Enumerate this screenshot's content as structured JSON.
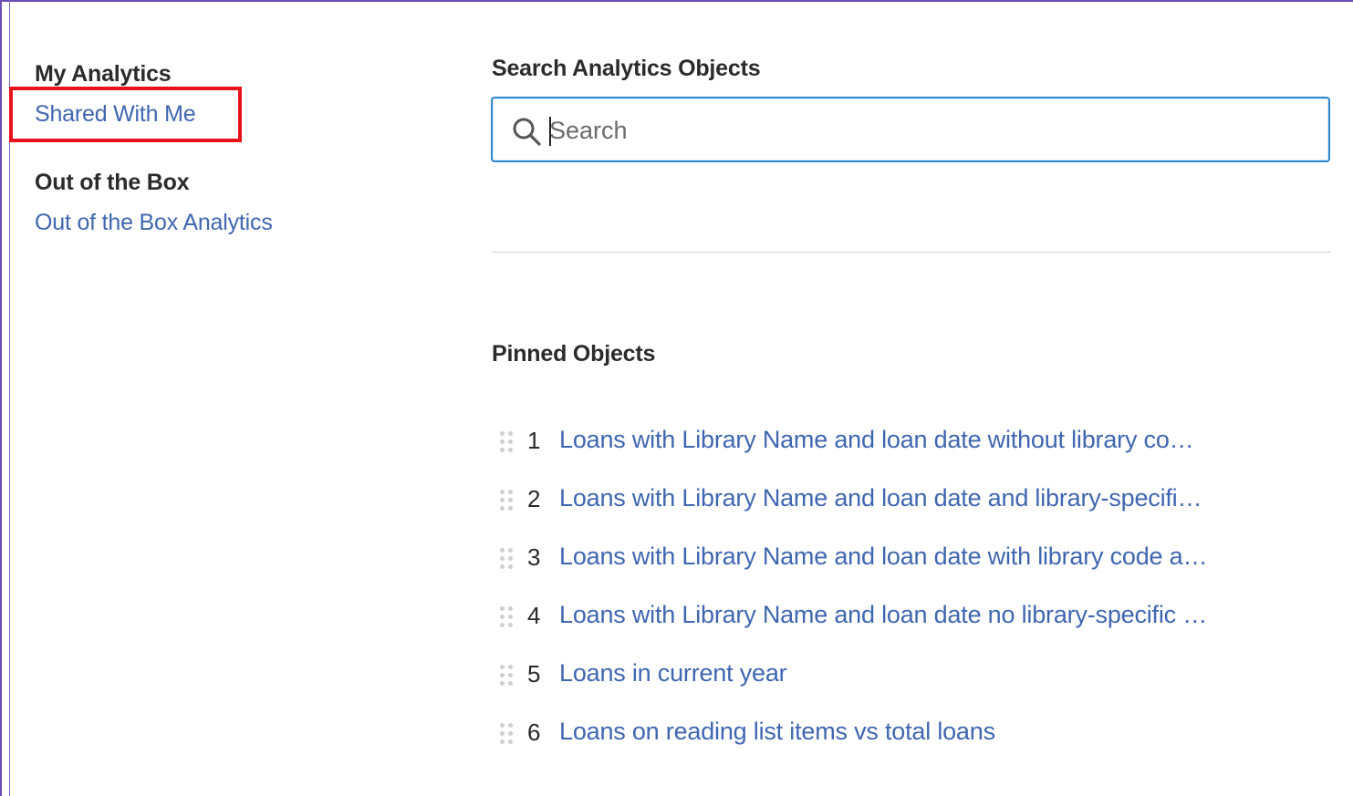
{
  "sidebar": {
    "my_analytics_heading": "My Analytics",
    "shared_with_me_link": "Shared With Me",
    "out_of_box_heading": "Out of the Box",
    "out_of_box_link": "Out of the Box Analytics"
  },
  "search": {
    "heading": "Search Analytics Objects",
    "placeholder": "Search",
    "value": ""
  },
  "pinned": {
    "heading": "Pinned Objects",
    "items": [
      {
        "number": "1",
        "label": "Loans with Library Name and loan date without library co…"
      },
      {
        "number": "2",
        "label": "Loans with Library Name and loan date and library-specifi…"
      },
      {
        "number": "3",
        "label": "Loans with Library Name and loan date with library code a…"
      },
      {
        "number": "4",
        "label": "Loans with Library Name and loan date no library-specific …"
      },
      {
        "number": "5",
        "label": "Loans in current year"
      },
      {
        "number": "6",
        "label": "Loans on reading list items vs total loans"
      }
    ]
  },
  "colors": {
    "link": "#3f66b0",
    "highlight": "#e8121b",
    "search_border": "#2f8ad0",
    "frame": "#6a4fb3"
  },
  "icons": {
    "search": "search-icon",
    "drag": "drag-handle-icon"
  }
}
